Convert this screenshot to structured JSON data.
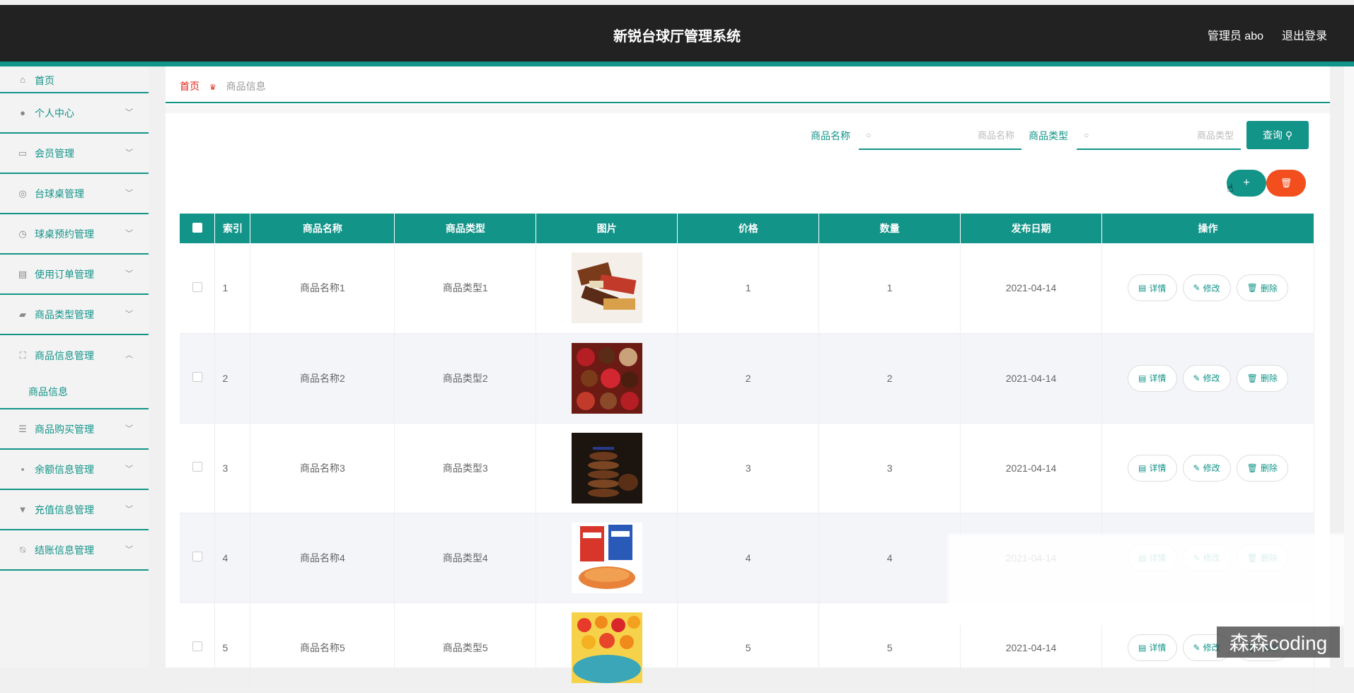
{
  "header": {
    "title": "新锐台球厅管理系统",
    "user": "管理员 abo",
    "logout": "退出登录"
  },
  "sidebar": {
    "items": [
      {
        "label": "首页",
        "icon": "home-icon"
      },
      {
        "label": "个人中心",
        "icon": "user-icon"
      },
      {
        "label": "会员管理",
        "icon": "chat-icon"
      },
      {
        "label": "台球桌管理",
        "icon": "compass-icon"
      },
      {
        "label": "球桌预约管理",
        "icon": "clock-icon"
      },
      {
        "label": "使用订单管理",
        "icon": "chart-icon"
      },
      {
        "label": "商品类型管理",
        "icon": "briefcase-icon"
      },
      {
        "label": "商品信息管理",
        "icon": "frame-icon"
      },
      {
        "label": "商品购买管理",
        "icon": "list-icon"
      },
      {
        "label": "余额信息管理",
        "icon": "message-icon"
      },
      {
        "label": "充值信息管理",
        "icon": "stand-icon"
      },
      {
        "label": "结账信息管理",
        "icon": "bell-off-icon"
      }
    ],
    "sub_item": "商品信息"
  },
  "breadcrumb": {
    "home": "首页",
    "current": "商品信息"
  },
  "search": {
    "name_label": "商品名称",
    "name_placeholder": "商品名称",
    "type_label": "商品类型",
    "type_placeholder": "商品类型",
    "query_label": "查询"
  },
  "table": {
    "columns": [
      "索引",
      "商品名称",
      "商品类型",
      "图片",
      "价格",
      "数量",
      "发布日期",
      "操作"
    ],
    "rows": [
      {
        "index": "1",
        "name": "商品名称1",
        "type": "商品类型1",
        "price": "1",
        "qty": "1",
        "date": "2021-04-14"
      },
      {
        "index": "2",
        "name": "商品名称2",
        "type": "商品类型2",
        "price": "2",
        "qty": "2",
        "date": "2021-04-14"
      },
      {
        "index": "3",
        "name": "商品名称3",
        "type": "商品类型3",
        "price": "3",
        "qty": "3",
        "date": "2021-04-14"
      },
      {
        "index": "4",
        "name": "商品名称4",
        "type": "商品类型4",
        "price": "4",
        "qty": "4",
        "date": "2021-04-14"
      },
      {
        "index": "5",
        "name": "商品名称5",
        "type": "商品类型5",
        "price": "5",
        "qty": "5",
        "date": "2021-04-14"
      }
    ],
    "actions": {
      "detail": "详情",
      "edit": "修改",
      "delete": "删除"
    }
  },
  "watermark": "森森coding",
  "colors": {
    "accent": "#139489",
    "danger": "#f24e1e",
    "header": "#222222"
  }
}
